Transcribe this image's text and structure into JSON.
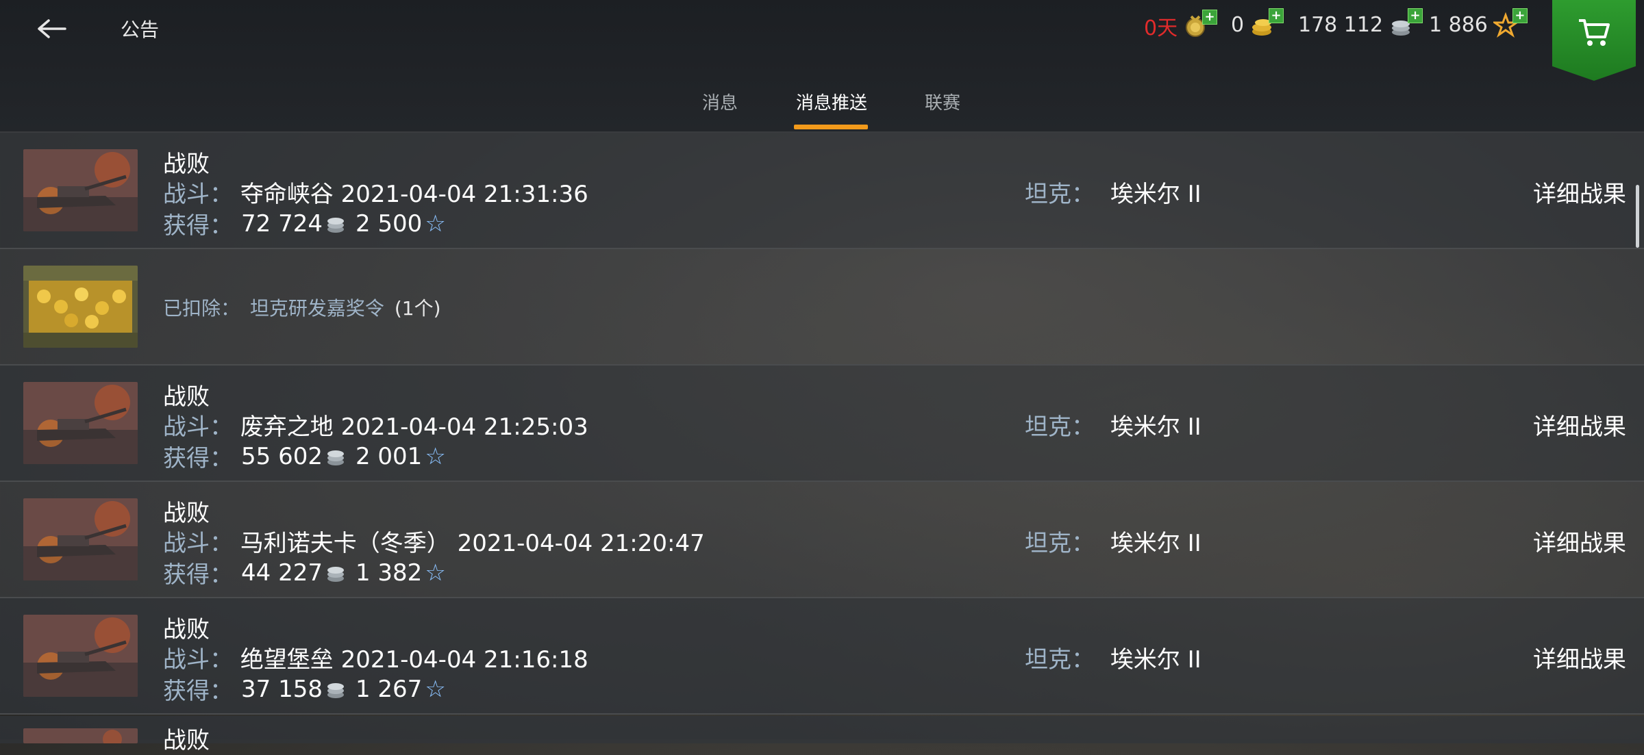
{
  "header": {
    "title": "公告",
    "currencies": {
      "premium_days": "0天",
      "gold": "0",
      "silver": "178 112",
      "free_xp": "1 886"
    }
  },
  "tabs": [
    {
      "label": "消息"
    },
    {
      "label": "消息推送",
      "active": true
    },
    {
      "label": "联赛"
    }
  ],
  "labels": {
    "battle": "战斗：",
    "earned": "获得：",
    "tank": "坦克：",
    "detail": "详细战果",
    "deducted": "已扣除："
  },
  "messages": [
    {
      "type": "battle",
      "result": "战败",
      "battle": "夺命峡谷 2021-04-04 21:31:36",
      "silver": "72 724",
      "xp": "2 500",
      "tank": "埃米尔 II"
    },
    {
      "type": "deduction",
      "item": "坦克研发嘉奖令",
      "count": "(1个)"
    },
    {
      "type": "battle",
      "result": "战败",
      "battle": "废弃之地 2021-04-04 21:25:03",
      "silver": "55 602",
      "xp": "2 001",
      "tank": "埃米尔 II"
    },
    {
      "type": "battle",
      "result": "战败",
      "battle": "马利诺夫卡（冬季） 2021-04-04 21:20:47",
      "silver": "44 227",
      "xp": "1 382",
      "tank": "埃米尔 II"
    },
    {
      "type": "battle",
      "result": "战败",
      "battle": "绝望堡垒 2021-04-04 21:16:18",
      "silver": "37 158",
      "xp": "1 267",
      "tank": "埃米尔 II"
    },
    {
      "type": "battle",
      "result": "战败"
    }
  ],
  "icons": {
    "back": "arrow-left-icon",
    "premium": "premium-medal-icon",
    "gold": "gold-coins-icon",
    "silver": "silver-coins-icon",
    "xp": "star-icon",
    "shop": "cart-icon"
  },
  "colors": {
    "accent": "#f29a1b",
    "shop": "#2e9c2f",
    "premium_days": "#e02b2b",
    "label": "#9fb4c8"
  }
}
